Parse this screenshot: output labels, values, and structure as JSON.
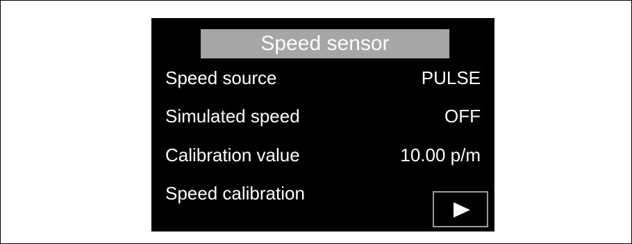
{
  "title": "Speed sensor",
  "rows": [
    {
      "label": "Speed source",
      "value": "PULSE"
    },
    {
      "label": "Simulated speed",
      "value": "OFF"
    },
    {
      "label": "Calibration value",
      "value": "10.00 p/m"
    },
    {
      "label": "Speed calibration",
      "value": ""
    }
  ],
  "next_button": {
    "icon": "play-icon"
  },
  "colors": {
    "screen_background": "#000000",
    "title_bar": "#a6a6a6",
    "text": "#ffffff",
    "button_border": "#9a9a9a"
  }
}
